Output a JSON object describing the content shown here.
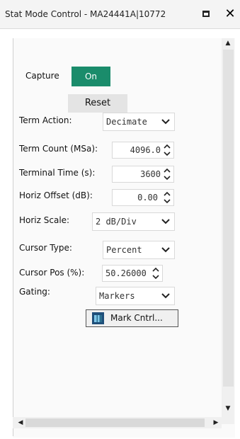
{
  "window": {
    "title": "Stat Mode Control - MA24441A|10772",
    "maximize_icon": "maximize-icon",
    "close_glyph": "✕"
  },
  "capture": {
    "label": "Capture",
    "state": "On",
    "on_color": "#1a8c6b"
  },
  "reset": {
    "label": "Reset"
  },
  "term_action": {
    "label": "Term Action:",
    "value": "Decimate"
  },
  "term_count": {
    "label": "Term Count (MSa):",
    "value": "4096.0"
  },
  "terminal_time": {
    "label": "Terminal Time (s):",
    "value": "3600"
  },
  "horiz_offset": {
    "label": "Horiz Offset (dB):",
    "value": "0.00"
  },
  "horiz_scale": {
    "label": "Horiz Scale:",
    "value": "2 dB/Div"
  },
  "cursor_type": {
    "label": "Cursor Type:",
    "value": "Percent"
  },
  "cursor_pos": {
    "label": "Cursor Pos (%):",
    "value": "50.26000"
  },
  "gating": {
    "label": "Gating:",
    "value": "Markers"
  },
  "mark_cntrl": {
    "label": "Mark Cntrl...",
    "icon": "chart-window-icon"
  },
  "scrollbars": {
    "up_glyph": "▲",
    "down_glyph": "▼",
    "left_glyph": "◀",
    "right_glyph": "▶"
  }
}
